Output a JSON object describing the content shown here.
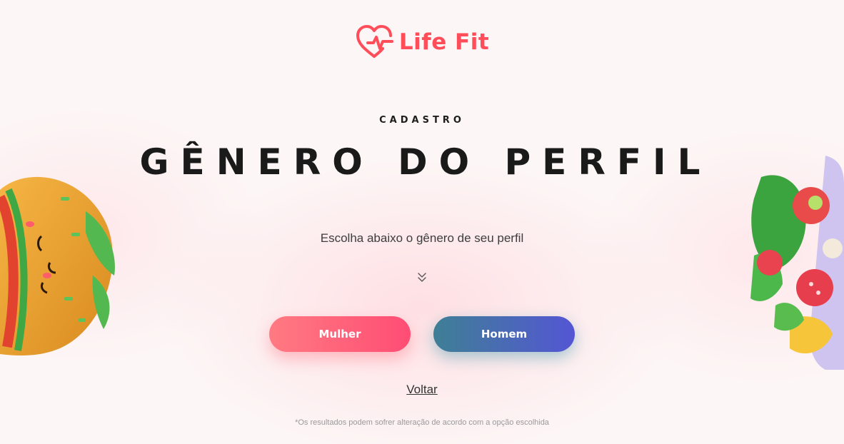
{
  "brand": {
    "name": "Life Fit",
    "logo_icon": "heart-pulse-icon",
    "color": "#ff4d5a"
  },
  "header": {
    "eyebrow": "CADASTRO",
    "title": "GÊNERO DO PERFIL"
  },
  "instructions": {
    "text": "Escolha abaixo o gênero de seu perfil",
    "icon": "double-chevron-down-icon"
  },
  "options": {
    "female_label": "Mulher",
    "male_label": "Homem",
    "female_color": "#ff5a78",
    "male_color": "#4a6cc0"
  },
  "back": {
    "label": "Voltar"
  },
  "footnote": "*Os resultados podem sofrer alteração de acordo com a opção escolhida",
  "illustrations": {
    "left": "burger-illustration",
    "right": "salad-bowl-illustration"
  }
}
